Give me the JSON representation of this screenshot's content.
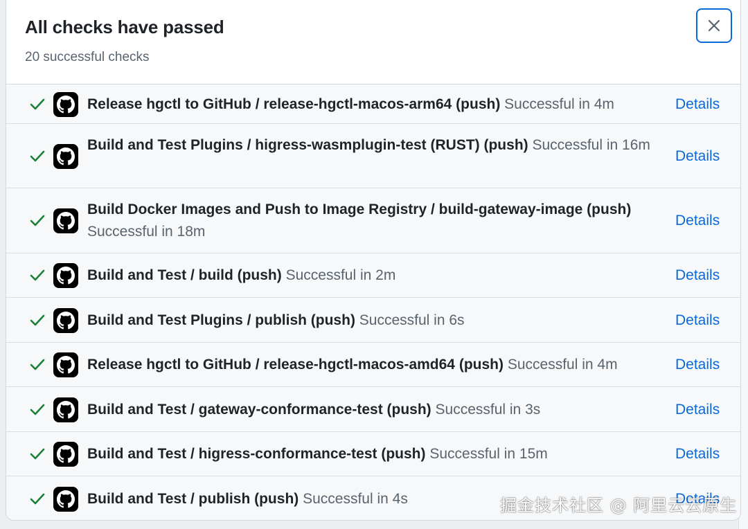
{
  "header": {
    "title": "All checks have passed",
    "subtitle": "20 successful checks"
  },
  "checks": [
    {
      "name": "Release hgctl to GitHub / release-hgctl-macos-arm64 (push)",
      "status": "Successful in 4m",
      "details": "Details"
    },
    {
      "name": "Build and Test Plugins / higress-wasmplugin-test (RUST) (push)",
      "status": "Successful in 16m",
      "details": "Details"
    },
    {
      "name": "Build Docker Images and Push to Image Registry / build-gateway-image (push)",
      "status": "Successful in 18m",
      "details": "Details"
    },
    {
      "name": "Build and Test / build (push)",
      "status": "Successful in 2m",
      "details": "Details"
    },
    {
      "name": "Build and Test Plugins / publish (push)",
      "status": "Successful in 6s",
      "details": "Details"
    },
    {
      "name": "Release hgctl to GitHub / release-hgctl-macos-amd64 (push)",
      "status": "Successful in 4m",
      "details": "Details"
    },
    {
      "name": "Build and Test / gateway-conformance-test (push)",
      "status": "Successful in 3s",
      "details": "Details"
    },
    {
      "name": "Build and Test / higress-conformance-test (push)",
      "status": "Successful in 15m",
      "details": "Details"
    },
    {
      "name": "Build and Test / publish (push)",
      "status": "Successful in 4s",
      "details": "Details"
    }
  ],
  "watermark": "掘金技术社区 @ 阿里云云原生",
  "colors": {
    "accent": "#0969da",
    "success": "#1a7f37",
    "text": "#1f2328",
    "muted": "#59636e"
  },
  "icons": {
    "check": "check-icon",
    "close": "close-icon",
    "app": "github-icon"
  }
}
